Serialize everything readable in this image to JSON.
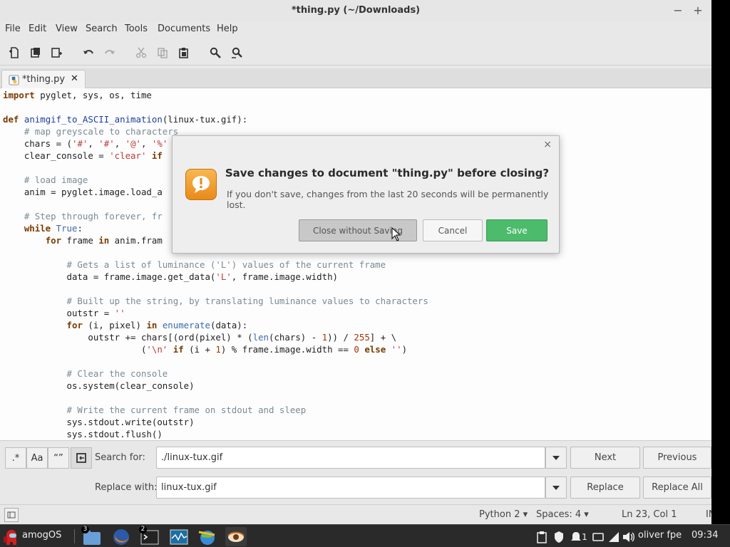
{
  "window": {
    "title": "*thing.py (~/Downloads)",
    "minimize": "−",
    "maximize": "+"
  },
  "menu": [
    "File",
    "Edit",
    "View",
    "Search",
    "Tools",
    "Documents",
    "Help"
  ],
  "tab": {
    "label": "*thing.py",
    "close": "✕"
  },
  "code": [
    "import pyglet, sys, os, time",
    "",
    "def animgif_to_ASCII_animation(linux-tux.gif):",
    "    # map greyscale to characters",
    "    chars = ('#', '#', '@', '%'",
    "    clear_console = 'clear' if",
    "",
    "    # load image",
    "    anim = pyglet.image.load_a",
    "",
    "    # Step through forever, fr",
    "    while True:",
    "        for frame in anim.fram",
    "",
    "            # Gets a list of luminance ('L') values of the current frame",
    "            data = frame.image.get_data('L', frame.image.width)",
    "",
    "            # Built up the string, by translating luminance values to characters",
    "            outstr = ''",
    "            for (i, pixel) in enumerate(data):",
    "                outstr += chars[(ord(pixel) * (len(chars) - 1)) / 255] + \\",
    "                          ('\\n' if (i + 1) % frame.image.width == 0 else '')",
    "",
    "            # Clear the console",
    "            os.system(clear_console)",
    "",
    "            # Write the current frame on stdout and sleep",
    "            sys.stdout.write(outstr)",
    "            sys.stdout.flush()"
  ],
  "search": {
    "regex_label": ".*",
    "case_label": "Aa",
    "word_label": "“”",
    "search_for_label": "Search for:",
    "search_value": "./linux-tux.gif",
    "replace_with_label": "Replace with:",
    "replace_value": "linux-tux.gif",
    "next": "Next",
    "previous": "Previous",
    "replace": "Replace",
    "replace_all": "Replace All"
  },
  "status": {
    "language": "Python 2",
    "spaces": "Spaces: 4",
    "position": "Ln 23, Col 1",
    "mode": "IN"
  },
  "dialog": {
    "close": "×",
    "title": "Save changes to document \"thing.py\" before closing?",
    "message": "If you don't save, changes from the last 20 seconds will be permanently lost.",
    "close_without_saving": "Close without Saving",
    "cancel": "Cancel",
    "save": "Save"
  },
  "taskbar": {
    "start_label": "amogOS",
    "files_badge": "3",
    "terminal_badge": "2",
    "notif_count": "1",
    "user": "oliver fpe",
    "clock": "09:34"
  },
  "colors": {
    "save_button": "#4cbb6c",
    "dialog_icon": "#f0a030",
    "taskbar": "#2a2a2a"
  }
}
